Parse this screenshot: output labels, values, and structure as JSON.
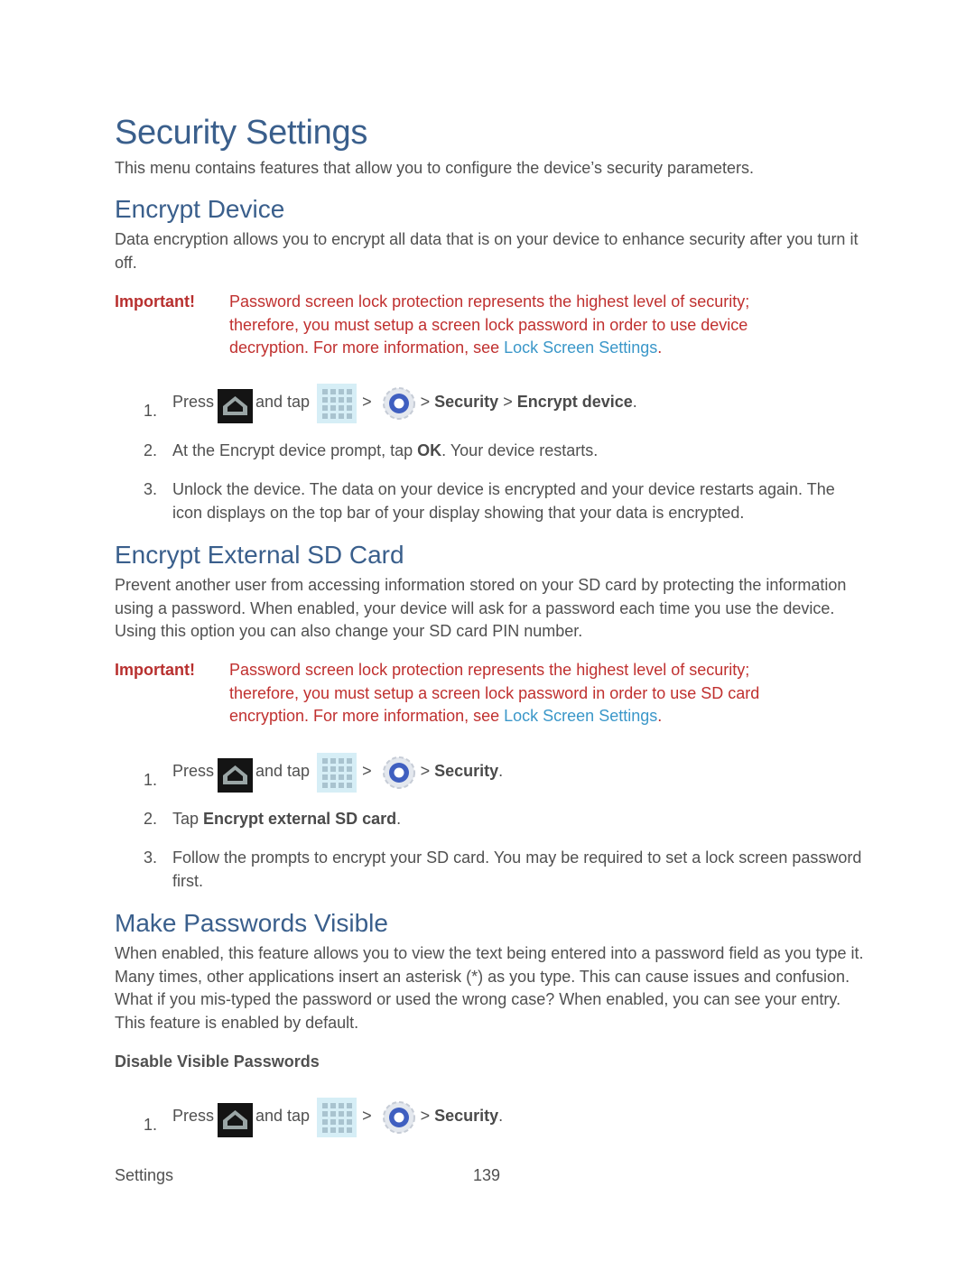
{
  "title": "Security Settings",
  "intro": "This menu contains features that allow you to configure the device’s security parameters.",
  "sections": {
    "encrypt_device": {
      "heading": "Encrypt Device",
      "body": "Data encryption allows you to encrypt all data that is on your device to enhance security after you turn it off.",
      "important_label": "Important!",
      "important_text": "Password screen lock protection represents the highest level of security; therefore, you must setup a screen lock password in order to use device decryption. For more information, see ",
      "important_link": "Lock Screen Settings",
      "important_end": ".",
      "steps": [
        {
          "num": "1.",
          "press": "Press",
          "and_tap": "and tap",
          "sep": ">",
          "sep2": ">",
          "b1": "Security",
          "sep3": ">",
          "b2": "Encrypt device",
          "end": "."
        },
        {
          "num": "2.",
          "pre": "At the Encrypt device prompt, tap ",
          "b": "OK",
          "post": ". Your device restarts."
        },
        {
          "num": "3.",
          "text": "Unlock the device. The data on your device is encrypted and your device restarts again. The icon displays on the top bar of your display showing that your data is encrypted."
        }
      ]
    },
    "encrypt_sd": {
      "heading": "Encrypt External SD Card",
      "body": "Prevent another user from accessing information stored on your SD card by protecting the information using a password. When enabled, your device will ask for a password each time you use the device. Using this option you can also change your SD card PIN number.",
      "important_label": "Important!",
      "important_text": "Password screen lock protection represents the highest level of security; therefore, you must setup a screen lock password in order to use SD card encryption. For more information, see ",
      "important_link": "Lock Screen Settings",
      "important_end": ".",
      "steps": [
        {
          "num": "1.",
          "press": "Press",
          "and_tap": "and tap",
          "sep": ">",
          "sep2": ">",
          "b1": "Security",
          "end": "."
        },
        {
          "num": "2.",
          "pre": "Tap ",
          "b": "Encrypt external SD card",
          "post": "."
        },
        {
          "num": "3.",
          "text": "Follow the prompts to encrypt your SD card. You may be required to set a lock screen password first."
        }
      ]
    },
    "passwords_visible": {
      "heading": "Make Passwords Visible",
      "body": "When enabled, this feature allows you to view the text being entered into a password field as you type it. Many times, other applications insert an asterisk (*) as you type. This can cause issues and confusion. What if you mis-typed the password or used the wrong case? When enabled, you can see your entry. This feature is enabled by default.",
      "subheading": "Disable Visible Passwords",
      "steps": [
        {
          "num": "1.",
          "press": "Press",
          "and_tap": "and tap",
          "sep": ">",
          "sep2": ">",
          "b1": "Security",
          "end": "."
        }
      ]
    }
  },
  "footer": {
    "section": "Settings",
    "page": "139"
  },
  "icons": {
    "home": "home-key-icon",
    "apps": "apps-grid-icon",
    "settings": "settings-gear-icon"
  }
}
